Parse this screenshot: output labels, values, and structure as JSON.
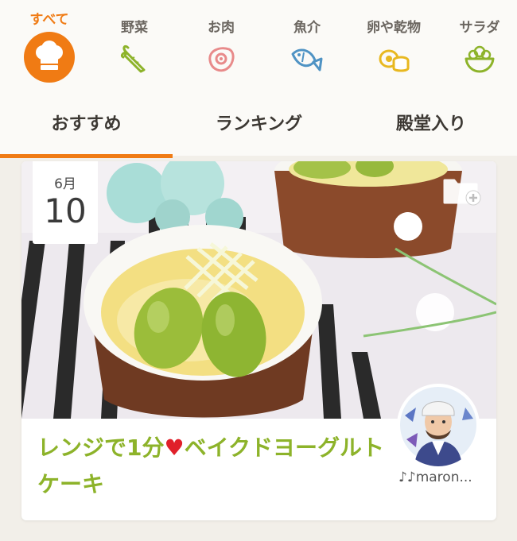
{
  "categories": [
    {
      "label": "すべて",
      "icon": "chef-hat-icon",
      "active": true
    },
    {
      "label": "野菜",
      "icon": "carrot-icon",
      "active": false
    },
    {
      "label": "お肉",
      "icon": "meat-icon",
      "active": false
    },
    {
      "label": "魚介",
      "icon": "fish-icon",
      "active": false
    },
    {
      "label": "卵や乾物",
      "icon": "egg-dried-goods-icon",
      "active": false
    },
    {
      "label": "サラダ",
      "icon": "salad-icon",
      "active": false
    }
  ],
  "tabs": [
    {
      "label": "おすすめ",
      "active": true
    },
    {
      "label": "ランキング",
      "active": false
    },
    {
      "label": "殿堂入り",
      "active": false
    }
  ],
  "recipe_card": {
    "date_month": "6月",
    "date_day": "10",
    "title_part1": "レンジで1分",
    "title_heart": "♥",
    "title_part2": "ベイクドヨーグルトケーキ",
    "author": "♪♪maron..."
  },
  "colors": {
    "accent": "#f07b14",
    "title_green": "#8db32a",
    "heart_red": "#e0202a",
    "icon_green": "#8db32a",
    "icon_pink": "#e88a8a",
    "icon_blue": "#4f93c4",
    "icon_yellow": "#e8b820"
  }
}
